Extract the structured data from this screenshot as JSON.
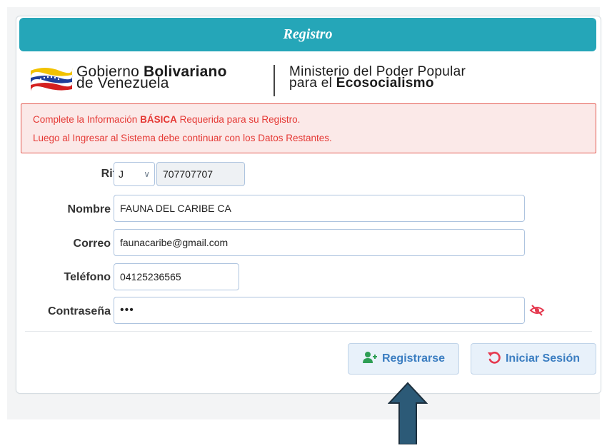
{
  "header": {
    "title": "Registro"
  },
  "brand": {
    "gov_line1_prefix": "Gobierno ",
    "gov_line1_bold": "Bolivariano",
    "gov_line2": "de Venezuela",
    "ministry_line1": "Ministerio del Poder Popular",
    "ministry_line2_prefix": "para el ",
    "ministry_line2_bold": "Ecosocialismo"
  },
  "alert": {
    "line1_prefix": "Complete la Información ",
    "line1_bold": "BÁSICA",
    "line1_suffix": " Requerida para su Registro.",
    "line2": "Luego al Ingresar al Sistema debe continuar con los Datos Restantes."
  },
  "form": {
    "rif_label": "Rif",
    "rif_type": "J",
    "rif_number": "707707707",
    "nombre_label": "Nombre",
    "nombre_value": "FAUNA DEL CARIBE CA",
    "correo_label": "Correo",
    "correo_value": "faunacaribe@gmail.com",
    "telefono_label": "Teléfono",
    "telefono_value": "04125236565",
    "contrasena_label": "Contraseña",
    "contrasena_value": "•••"
  },
  "buttons": {
    "register": "Registrarse",
    "login": "Iniciar Sesión"
  },
  "colors": {
    "header": "#25a6b8",
    "alert_text": "#e53935",
    "button_text": "#3a7dc1",
    "register_icon": "#2e9e54",
    "login_icon": "#e5394f",
    "arrow": "#2c5a77"
  },
  "icons": {
    "flag": "venezuela-flag-icon",
    "eye": "eye-slash-icon",
    "register": "user-plus-icon",
    "login": "undo-icon",
    "arrow": "up-arrow-icon"
  }
}
